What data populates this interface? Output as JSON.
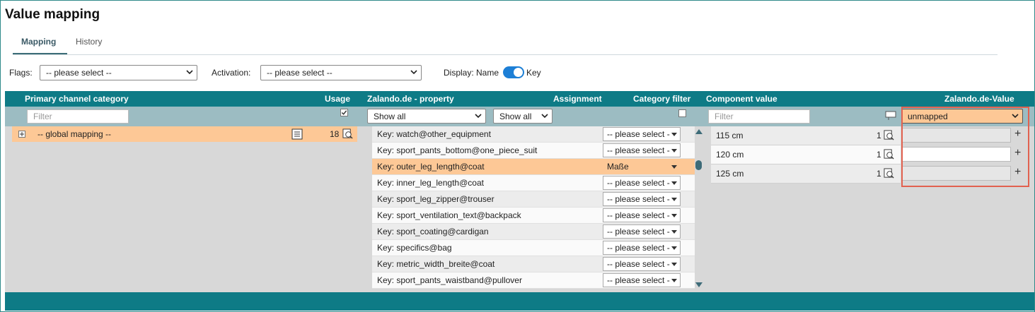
{
  "page": {
    "title": "Value mapping"
  },
  "tabs": [
    {
      "label": "Mapping"
    },
    {
      "label": "History"
    }
  ],
  "filters": {
    "flags_label": "Flags:",
    "flags_value": "-- please select --",
    "activation_label": "Activation:",
    "activation_value": "-- please select --",
    "display_label": "Display: Name",
    "display_key_label": "Key"
  },
  "grid": {
    "headers": {
      "primary_category": "Primary channel category",
      "usage": "Usage",
      "property": "Zalando.de - property",
      "assignment": "Assignment",
      "category_filter": "Category filter",
      "component_value": "Component value",
      "zalando_value": "Zalando.de-Value"
    },
    "filter_row": {
      "category_placeholder": "Filter",
      "property_filter_1": "Show all",
      "property_filter_2": "Show all",
      "component_placeholder": "Filter",
      "value_filter": "unmapped"
    },
    "category_row": {
      "expander": "⊞",
      "label": "-- global mapping --",
      "usage_count": "18"
    },
    "properties": [
      {
        "key": "Key: watch@other_equipment",
        "assignment": "-- please select -"
      },
      {
        "key": "Key: sport_pants_bottom@one_piece_suit",
        "assignment": "-- please select -"
      },
      {
        "key": "Key: outer_leg_length@coat",
        "assignment": "Maße",
        "highlighted": true
      },
      {
        "key": "Key: inner_leg_length@coat",
        "assignment": "-- please select -"
      },
      {
        "key": "Key: sport_leg_zipper@trouser",
        "assignment": "-- please select -"
      },
      {
        "key": "Key: sport_ventilation_text@backpack",
        "assignment": "-- please select -"
      },
      {
        "key": "Key: sport_coating@cardigan",
        "assignment": "-- please select -"
      },
      {
        "key": "Key: specifics@bag",
        "assignment": "-- please select -"
      },
      {
        "key": "Key: metric_width_breite@coat",
        "assignment": "-- please select -"
      },
      {
        "key": "Key: sport_pants_waistband@pullover",
        "assignment": "-- please select -"
      }
    ],
    "component_values": [
      {
        "value": "115 cm",
        "count": "1"
      },
      {
        "value": "120 cm",
        "count": "1"
      },
      {
        "value": "125 cm",
        "count": "1"
      }
    ]
  },
  "colors": {
    "header": "#0e7b86",
    "highlight": "#fdc896",
    "filter_row": "#9cbcc2",
    "highlight_box": "#e2614f"
  },
  "icons": [
    "expand-icon",
    "list-icon",
    "zoom-icon",
    "checkbox-icon",
    "chevron-down-icon",
    "scroll-up-icon",
    "scroll-down-icon",
    "plus-icon",
    "column-icon"
  ]
}
